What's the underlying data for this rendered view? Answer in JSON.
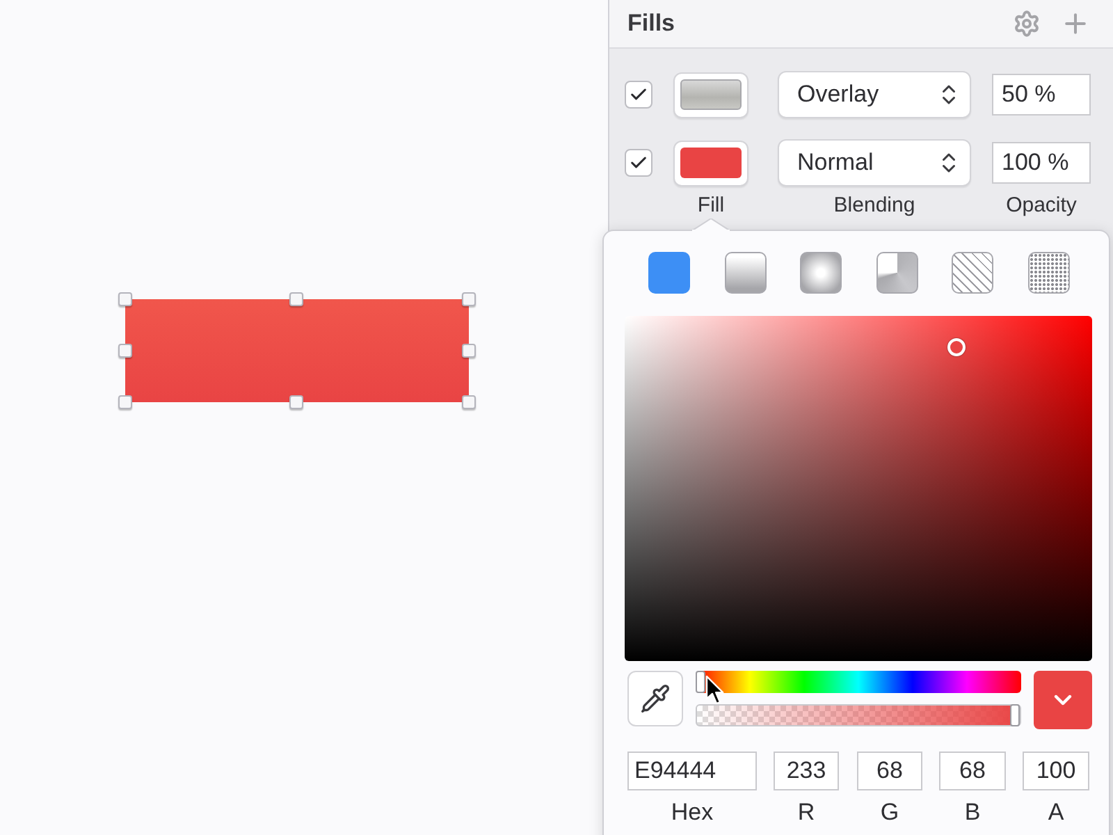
{
  "canvas": {
    "shape": {
      "selected": true
    }
  },
  "fills_panel": {
    "title": "Fills",
    "fills": [
      {
        "checked": true,
        "kind": "image",
        "blending": "Overlay",
        "opacity": "50 %"
      },
      {
        "checked": true,
        "kind": "solid",
        "color": "#e94444",
        "blending": "Normal",
        "opacity": "100 %"
      }
    ],
    "column_labels": [
      "Fill",
      "Blending",
      "Opacity"
    ]
  },
  "color_popover": {
    "fill_types": [
      {
        "kind": "solid",
        "selected": true
      },
      {
        "kind": "linear",
        "selected": false
      },
      {
        "kind": "radial",
        "selected": false
      },
      {
        "kind": "angular",
        "selected": false
      },
      {
        "kind": "pattern",
        "selected": false
      },
      {
        "kind": "noise",
        "selected": false
      }
    ],
    "saturation": {
      "level": 0.71
    },
    "brightness": {
      "level": 0.91
    },
    "hue": {
      "level": 0
    },
    "alpha": {
      "level": 1
    },
    "fields": [
      {
        "value": "E94444",
        "label": "Hex"
      },
      {
        "value": "233",
        "label": "R"
      },
      {
        "value": "68",
        "label": "G"
      },
      {
        "value": "68",
        "label": "B"
      },
      {
        "value": "100",
        "label": "A"
      }
    ]
  }
}
